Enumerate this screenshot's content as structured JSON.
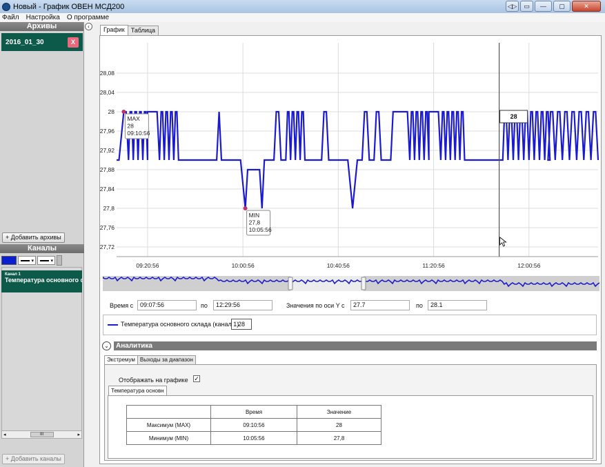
{
  "window": {
    "title": "Новый - График ОВЕН МСД200"
  },
  "menu": [
    "Файл",
    "Настройка",
    "О программе"
  ],
  "sidebar": {
    "archives_header": "Архивы",
    "archive_item": "2016_01_30",
    "archive_close": "X",
    "add_archives": "+ Добавить архивы",
    "channels_header": "Каналы",
    "channel_sub": "Канал 1",
    "channel_name": "Температура основного склада",
    "add_channels": "+ Добавить каналы",
    "scroll_thumb": "III"
  },
  "tabs": [
    "График",
    "Таблица"
  ],
  "chart_data": {
    "type": "line",
    "title": "",
    "xlabel": "",
    "ylabel": "",
    "x_ticks": [
      "09:20:56",
      "10:00:56",
      "10:40:56",
      "11:20:56",
      "12:00:56"
    ],
    "y_ticks": [
      "27,72",
      "27,76",
      "27,8",
      "27,84",
      "27,88",
      "27,92",
      "27,96",
      "28",
      "28,04",
      "28,08"
    ],
    "ylim": [
      27.7,
      28.1
    ],
    "xlim": [
      "09:07:56",
      "12:29:56"
    ],
    "grid": true,
    "series": [
      {
        "name": "Температура основного склада (канал 1)",
        "color": "#1a1ad0",
        "points_minutes_after_0907_56": []
      }
    ],
    "max_annotation": {
      "label": "MAX",
      "value": "28",
      "time": "09:10:56"
    },
    "min_annotation": {
      "label": "MIN",
      "value": "27,8",
      "time": "10:05:56"
    },
    "cursor_value": "28"
  },
  "range": {
    "time_from_label": "Время с",
    "time_from": "09:07:56",
    "to_label": "по",
    "time_to": "12:29:56",
    "y_label": "Значения по оси Y с",
    "y_from": "27.7",
    "y_to_label": "по",
    "y_to": "28.1"
  },
  "legend": {
    "label": "Температура основного склада (канал 1)",
    "value": "28"
  },
  "analytics": {
    "header": "Аналитика",
    "tabs": [
      "Экстремум",
      "Выходы за диапазон"
    ],
    "show_on_chart": "Отображать на графике",
    "checkmark": "✓",
    "channel_tab": "Температура основн",
    "table": {
      "headers": [
        "",
        "Время",
        "Значение"
      ],
      "rows": [
        [
          "Максимум (MAX)",
          "09:10:56",
          "28"
        ],
        [
          "Минимум (MIN)",
          "10:05:56",
          "27,8"
        ]
      ]
    }
  }
}
